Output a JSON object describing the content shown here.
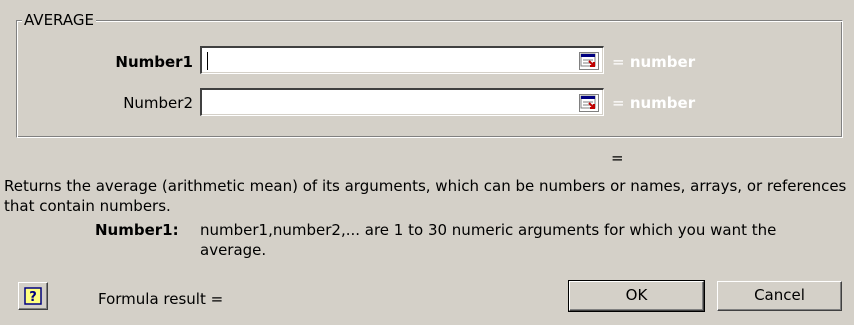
{
  "function_group": {
    "legend": "AVERAGE",
    "arguments": [
      {
        "label": "Number1",
        "value": "",
        "result_sign": "=",
        "result_text": "number",
        "bold": true
      },
      {
        "label": "Number2",
        "value": "",
        "result_sign": "=",
        "result_text": "number",
        "bold": false
      }
    ]
  },
  "result_sign": "=",
  "description": "Returns the average (arithmetic mean) of its arguments, which can be numbers or names, arrays, or references that contain numbers.",
  "argument_help": {
    "label": "Number1:",
    "text": "number1,number2,... are 1 to 30 numeric arguments for which you want the average."
  },
  "footer": {
    "help_icon": "question-mark-icon",
    "formula_result_label": "Formula result =",
    "ok_label": "OK",
    "cancel_label": "Cancel"
  },
  "colors": {
    "dialog_bg": "#d4d0c8",
    "result_text": "#ffffff"
  }
}
